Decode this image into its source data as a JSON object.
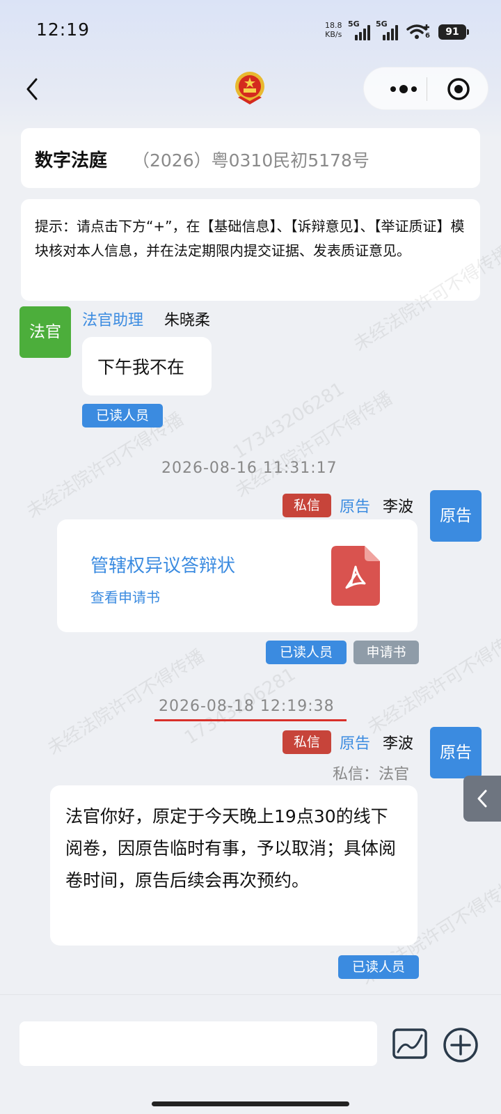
{
  "status_bar": {
    "time": "12:19",
    "speed_value": "18.8",
    "speed_unit": "KB/s",
    "net1": "5G",
    "net2": "5G",
    "wifi_sub": "6",
    "battery": "91"
  },
  "header": {
    "back_icon": "chevron-left-icon",
    "emblem_icon": "national-emblem-icon",
    "more_icon": "more-dots-icon",
    "close_icon": "target-circle-icon"
  },
  "title_card": {
    "title": "数字法庭",
    "case_no": "（2026）粤0310民初5178号"
  },
  "tip": {
    "text": "提示：请点击下方“+”，在【基础信息】、【诉辩意见】、【举证质证】模块核对本人信息，并在法定期限内提交证据、发表质证意见。"
  },
  "watermark": {
    "line1": "未经法院许可不得传播",
    "line2": "17343206281",
    "line3": "李波"
  },
  "messages": [
    {
      "avatar": "法官",
      "role": "法官助理",
      "name": "朱晓柔",
      "text": "下午我不在",
      "read_tag": "已读人员"
    },
    {
      "timestamp": "2026-08-16 11:31:17",
      "private_tag": "私信",
      "role": "原告",
      "name": "李波",
      "avatar": "原告",
      "file_title": "管辖权异议答辩状",
      "file_link": "查看申请书",
      "file_icon": "pdf-icon",
      "read_tag": "已读人员",
      "type_tag": "申请书"
    },
    {
      "timestamp": "2026-08-18 12:19:38",
      "private_tag": "私信",
      "role": "原告",
      "name": "李波",
      "avatar": "原告",
      "private_to": "私信：法官",
      "text": "法官你好，原定于今天晚上19点30的线下阅卷，因原告临时有事，予以取消；具体阅卷时间，原告后续会再次预约。",
      "read_tag": "已读人员"
    }
  ],
  "side_tab": {
    "icon": "chevron-left-icon"
  },
  "input_bar": {
    "input_value": "",
    "chart_icon": "chart-image-icon",
    "add_icon": "plus-circle-icon"
  },
  "colors": {
    "blue": "#3b8be0",
    "green": "#4cae3b",
    "red": "#c7443a",
    "underline": "#d9302a"
  }
}
